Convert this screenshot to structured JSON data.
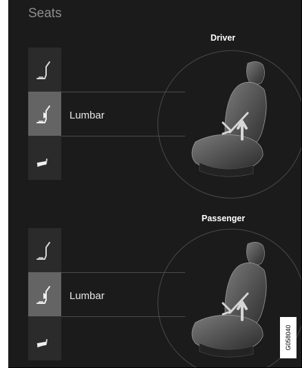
{
  "screen": {
    "title": "Seats"
  },
  "groups": [
    {
      "label": "Driver",
      "selected_button": "Lumbar",
      "buttons": [
        "seat-back-icon",
        "lumbar-icon",
        "seat-cushion-icon"
      ]
    },
    {
      "label": "Passenger",
      "selected_button": "Lumbar",
      "buttons": [
        "seat-back-icon",
        "lumbar-icon",
        "seat-cushion-icon"
      ]
    }
  ],
  "image_code": "G058040",
  "colors": {
    "background": "#1b1b1b",
    "selected": "#646464",
    "button": "#2b2b2b",
    "title": "#8e8e8e"
  }
}
